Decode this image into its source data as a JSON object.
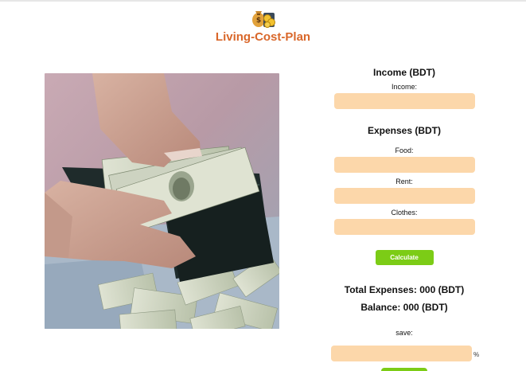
{
  "app": {
    "title": "Living-Cost-Plan",
    "logo_icon": "money-bag-coins-icon"
  },
  "image": {
    "alt": "hands-opening-wallet-with-dollar-bills"
  },
  "income": {
    "heading": "Income (BDT)",
    "label": "Income:",
    "value": ""
  },
  "expenses": {
    "heading": "Expenses (BDT)",
    "food_label": "Food:",
    "food_value": "",
    "rent_label": "Rent:",
    "rent_value": "",
    "clothes_label": "Clothes:",
    "clothes_value": ""
  },
  "actions": {
    "calculate_label": "Calculate",
    "save_button_label": ""
  },
  "summary": {
    "total_expenses": "Total Expenses: 000 (BDT)",
    "balance": "Balance: 000 (BDT)"
  },
  "save": {
    "label": "save:",
    "value": "",
    "unit": "%"
  },
  "colors": {
    "title": "#d9672a",
    "input_bg": "#fcd7aa",
    "button": "#7ccc16"
  }
}
